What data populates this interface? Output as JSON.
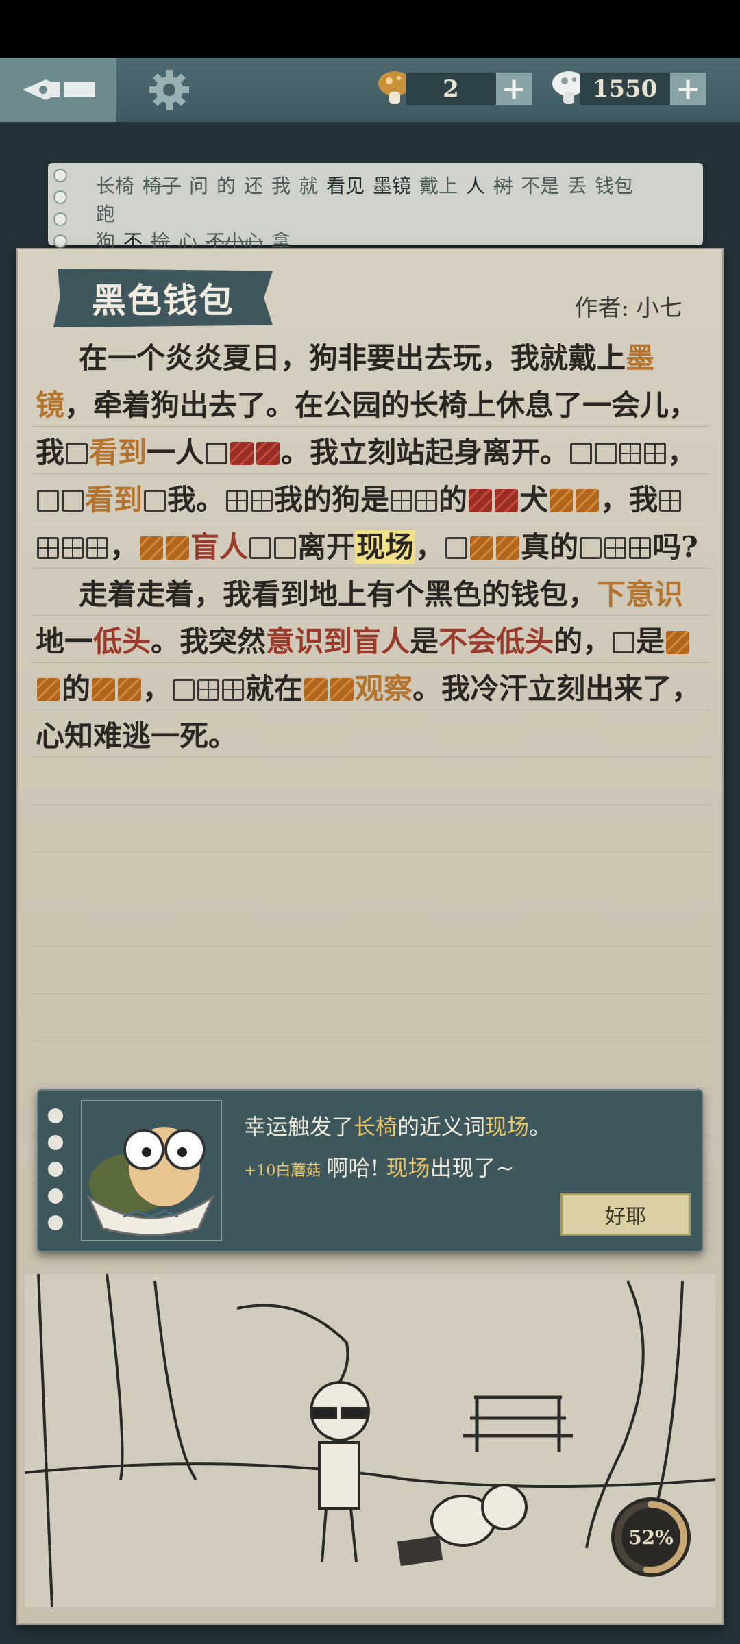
{
  "topbar": {
    "back_icon": "pen-nib-back-icon",
    "settings_icon": "gear-icon",
    "currency_a": {
      "icon": "brown-mushroom-icon",
      "value": "2",
      "plus": "+"
    },
    "currency_b": {
      "icon": "white-mushroom-icon",
      "value": "1550",
      "plus": "+"
    }
  },
  "hint_strip": {
    "line1": [
      "长椅",
      "椅子",
      "问",
      "的",
      "还",
      "我",
      "就",
      "看见",
      "墨镜",
      "戴上",
      "人",
      "树",
      "不是",
      "丢",
      "钱包",
      "跑"
    ],
    "line2": [
      "狗",
      "不",
      "捡",
      "心",
      "不小心",
      "拿"
    ]
  },
  "note": {
    "title": "黑色钱包",
    "author_label": "作者:",
    "author_name": "小七"
  },
  "story": {
    "p1": {
      "t1": "在一个炎炎夏日，狗非要出去玩，我就戴上",
      "w_sunglasses": "墨镜",
      "t2": "，牵着狗出去了。在公园的长椅上休息了一会儿，我",
      "w_see1": "看到",
      "t3": "一人",
      "t4": "。我立刻站起身离开。",
      "t5": "，",
      "w_see2": "看到",
      "t6": "我。",
      "t7": "我的狗是",
      "t8": "的",
      "t9": "犬",
      "t10": "，我",
      "t11": "，",
      "w_blind1": "盲人",
      "t12": "离开",
      "w_scene": "现场",
      "t13": "，",
      "t14": "真的",
      "t15": "吗?"
    },
    "p2": {
      "t1": "走着走着，我看到地上有个黑色的钱包，",
      "w_sub": "下意识",
      "t2": "地一",
      "w_low": "低头",
      "t3": "。我突然",
      "w_realize": "意识到",
      "w_blind2": "盲人",
      "t4": "是",
      "w_notlow": "不会低头",
      "t5": "的，",
      "t6": "是",
      "t7": "的",
      "t8": "，",
      "t9": "就在",
      "w_observe": "观察",
      "t10": "。我冷汗立刻出来了，心知难逃一死。"
    }
  },
  "popup": {
    "msg1_pre": "幸运触发了",
    "msg1_word": "长椅",
    "msg1_mid": "的近义词",
    "msg1_result": "现场",
    "msg1_end": "。",
    "reward": "+10白蘑菇",
    "msg2_pre": "啊哈!",
    "msg2_word": "现场",
    "msg2_end": "出现了~",
    "ok_label": "好耶",
    "avatar_icon": "turtle-with-glasses-icon"
  },
  "illustration": {
    "icon": "park-scene-boy-with-dog-illustration"
  },
  "progress": {
    "label": "52%",
    "value": 52
  }
}
